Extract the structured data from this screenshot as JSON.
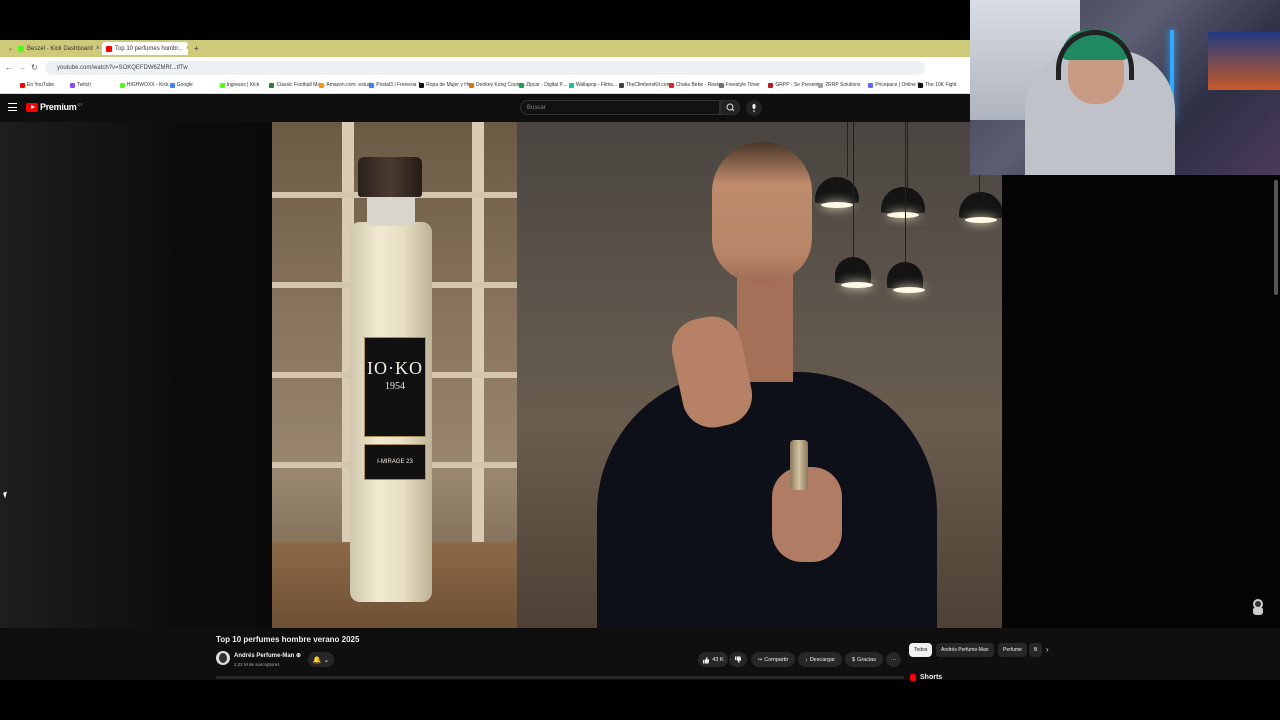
{
  "browser": {
    "tabs": [
      {
        "label": "Beszel - Kick Dashboard",
        "color": "#53fc18"
      },
      {
        "label": "Top 10 perfumes hombr...",
        "color": "#ff0000"
      }
    ],
    "new_tab": "+",
    "url": "youtube.com/watch?v=SOKQEFDW6ZMRf...tfTw",
    "bookmarks": [
      {
        "label": "En YouTube",
        "color": "#ff0000"
      },
      {
        "label": "Twitch",
        "color": "#9146ff"
      },
      {
        "label": "HIGHWOXX - Kick...",
        "color": "#53fc18"
      },
      {
        "label": "Google",
        "color": "#4285f4"
      },
      {
        "label": "Ingresos | Kick",
        "color": "#53fc18"
      },
      {
        "label": "Classic Football Ma...",
        "color": "#2e7d32"
      },
      {
        "label": "Amazon.com: estud...",
        "color": "#ff9900"
      },
      {
        "label": "Postal3 | Frenesia T...",
        "color": "#3b82f6"
      },
      {
        "label": "Ropa de Mujer y Ho...",
        "color": "#111111"
      },
      {
        "label": "Donkey Kong Count...",
        "color": "#d97706"
      },
      {
        "label": "Zipcar - Digital P...",
        "color": "#16a34a"
      },
      {
        "label": "Wallapop - Films...",
        "color": "#13c1ac"
      },
      {
        "label": "TheClimbersKit.com...",
        "color": "#444444"
      },
      {
        "label": "Chaka Bebe - Resta...",
        "color": "#dc2626"
      },
      {
        "label": "Freestyle Timer",
        "color": "#6b7280"
      },
      {
        "label": "GRPP - Se Presentar",
        "color": "#b91c1c"
      },
      {
        "label": "2RRP Solutions",
        "color": "#9ca3af"
      },
      {
        "label": "Pricepace | Online P...",
        "color": "#6366f1"
      },
      {
        "label": "The 10K Fight",
        "color": "#111111"
      }
    ]
  },
  "youtube": {
    "logo_text": "Premium",
    "logo_sup": "GT",
    "search_placeholder": "Buscar",
    "video": {
      "label_brand": "IO·KO",
      "label_year": "1954",
      "label_sub": "I-MIRAGE 23"
    },
    "title": "Top 10 perfumes hombre verano 2025",
    "channel": {
      "name": "Andrés Perfume-Man ⊕",
      "subs": "2,22 M de suscriptores"
    },
    "bell": "🔔 ⌄",
    "actions": {
      "likes": "43 K",
      "dislike": "",
      "share": "Compartir",
      "download": "Descargar",
      "thanks": "Gracias",
      "more": "···"
    },
    "chips": [
      "Todos",
      "Andrés Perfume-Man",
      "Perfume",
      "B"
    ],
    "chips_next": "›",
    "shorts": "Shorts"
  }
}
